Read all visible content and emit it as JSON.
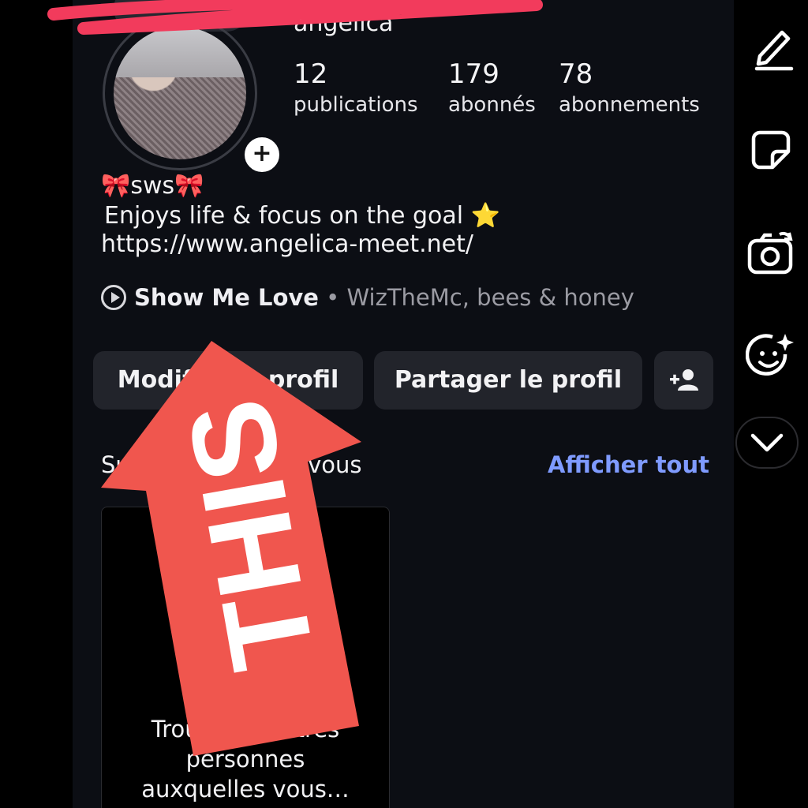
{
  "profile": {
    "top_pill_text": "…",
    "username": "angelica",
    "stats": [
      {
        "value": "12",
        "label": "publications"
      },
      {
        "value": "179",
        "label": "abonnés"
      },
      {
        "value": "78",
        "label": "abonnements"
      }
    ],
    "bio_name": "🎀sws🎀",
    "bio_line": " Enjoys life & focus on the goal ⭐",
    "bio_link": "https://www.angelica-meet.net/",
    "music_title": "Show Me Love",
    "music_sep": " • ",
    "music_artist": "WizTheMc, bees & honey"
  },
  "buttons": {
    "edit_profile": "Modifier le profil",
    "share_profile": "Partager le profil"
  },
  "suggestions": {
    "title": "Suggestions pour vous",
    "see_all": "Afficher tout",
    "card_text_line1": "Trouvez d'autres",
    "card_text_line2": "personnes",
    "card_text_line3": "auxquelles vous…"
  },
  "overlay": {
    "arrow_text": "THIS",
    "arrow_color": "#f0564e",
    "scribble_color": "#f23b5c"
  },
  "colors": {
    "background": "#0c0e14",
    "button": "#22242b",
    "link_blue": "#7f9bff"
  },
  "icons": {
    "rail": [
      "pen-icon",
      "sticker-icon",
      "camera-flip-icon",
      "face-sparkle-icon",
      "chevron-down-icon"
    ],
    "profile": [
      "add-story-icon",
      "play-icon",
      "add-person-icon"
    ]
  }
}
